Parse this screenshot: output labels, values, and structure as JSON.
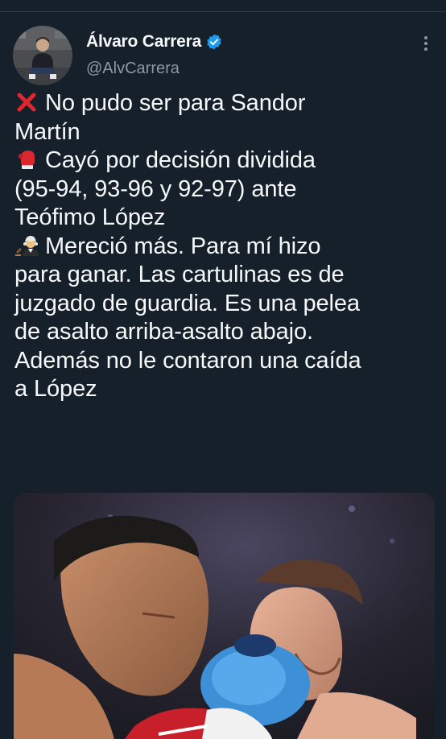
{
  "tweet": {
    "author": {
      "display_name": "Álvaro Carrera",
      "handle": "@AlvCarrera",
      "verified": true,
      "avatar_icon": "profile-photo"
    },
    "more_icon": "more-vertical-icon",
    "lines": [
      {
        "emoji": "cross-mark-icon",
        "text": "No pudo ser para Sandor"
      },
      {
        "emoji": "",
        "text": "Martín"
      },
      {
        "emoji": "boxing-glove-icon",
        "text": "Cayó por decisión dividida"
      },
      {
        "emoji": "",
        "text": "(95-94, 93-96 y 92-97) ante"
      },
      {
        "emoji": "",
        "text": "Teófimo López"
      },
      {
        "emoji": "judge-icon",
        "text": "Mereció más. Para mí hizo"
      },
      {
        "emoji": "",
        "text": "para ganar. Las cartulinas es de"
      },
      {
        "emoji": "",
        "text": "juzgado de guardia. Es una pelea"
      },
      {
        "emoji": "",
        "text": "de asalto arriba-asalto abajo."
      },
      {
        "emoji": "",
        "text": "Además no le contaron una caída"
      },
      {
        "emoji": "",
        "text": "a López"
      }
    ],
    "media": {
      "type": "photo"
    }
  },
  "colors": {
    "background": "#15202b",
    "text": "#f7f9f9",
    "secondary": "#8b98a5",
    "verified": "#1d9bf0",
    "cross": "#e0262f"
  }
}
